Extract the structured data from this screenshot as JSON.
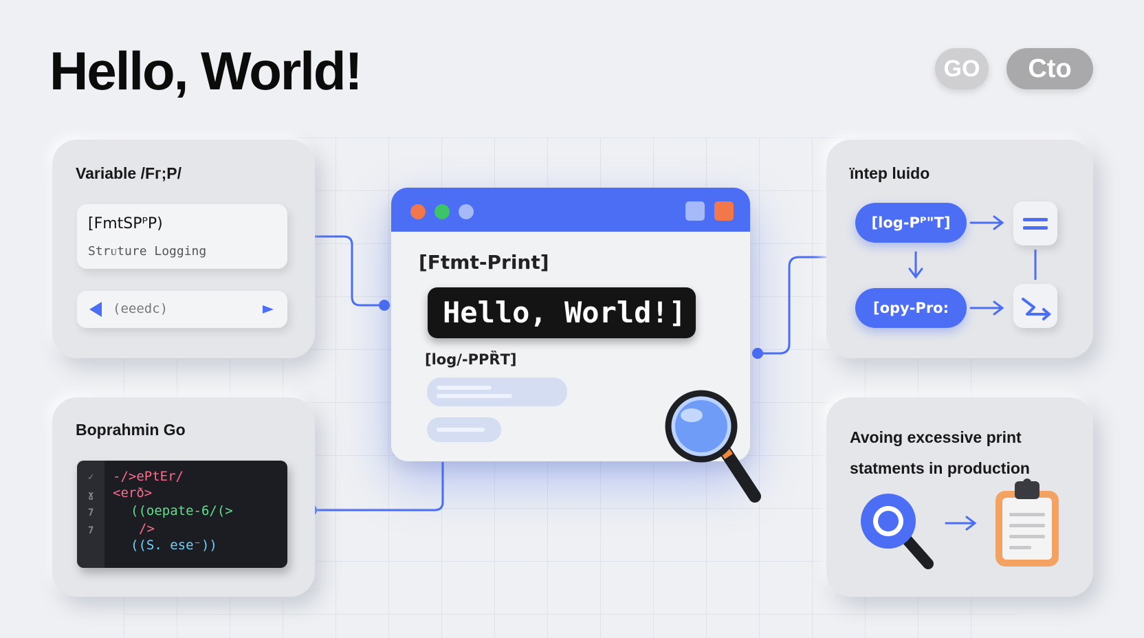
{
  "header": {
    "title": "Hello, World!",
    "pill_go": "GO",
    "pill_cto": "Cto"
  },
  "card_variable": {
    "title": "Variable /Fᴦ;P/",
    "field_main": "[FmtSPᴾP)",
    "field_sub": "Strᴜture Logging",
    "input_value": "(eeedc)"
  },
  "card_code": {
    "title": "Boprahmin Go",
    "line_numbers": [
      "✓",
      "ɣ",
      "7",
      "7"
    ],
    "lines": [
      "-/>ePtEr/",
      "<erð>",
      "((oepate-6/(>",
      "/>",
      "((S. ese⁻))"
    ]
  },
  "window": {
    "heading": "[Ftmt-Print]",
    "hello": "Hello, World!]",
    "log_label": "[log/-PPȐT]"
  },
  "card_interp": {
    "title": "ïntep luido",
    "node_top": "[log-Pᴾ\"T]",
    "node_bottom": "[opy-Pro:"
  },
  "card_avoid": {
    "text": "Avoing excessive print statments in production"
  },
  "colors": {
    "accent": "#4b6ef5",
    "dot_red": "#f2784b",
    "dot_green": "#3cc46b",
    "dot_blue": "#a6b9f8",
    "clipboard": "#f4a261"
  }
}
